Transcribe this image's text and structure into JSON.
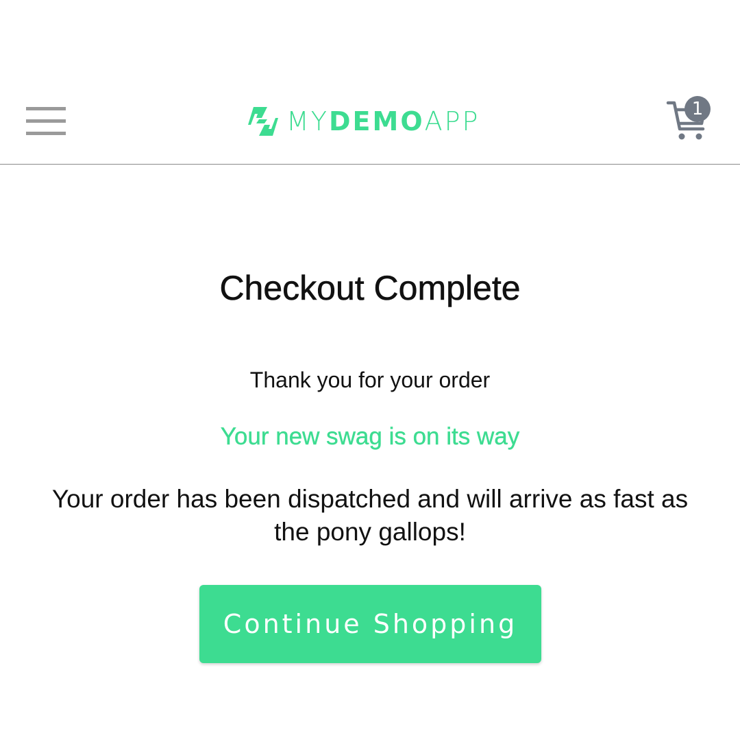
{
  "header": {
    "logo": {
      "part_my": "MY",
      "part_demo": "DEMO",
      "part_app": "APP",
      "icon": "mydemoapp-logo-icon"
    },
    "menu_icon": "hamburger-menu-icon",
    "cart": {
      "icon": "cart-icon",
      "badge_count": "1"
    }
  },
  "main": {
    "title": "Checkout Complete",
    "thank_you": "Thank you for your order",
    "swag_message": "Your new swag is on its way",
    "dispatch_message": "Your order has been dispatched and will arrive as fast as the pony gallops!",
    "continue_button": "Continue Shopping"
  },
  "colors": {
    "accent": "#3ddc91",
    "badge": "#707884",
    "menu": "#9a9a9a",
    "text": "#111111"
  }
}
